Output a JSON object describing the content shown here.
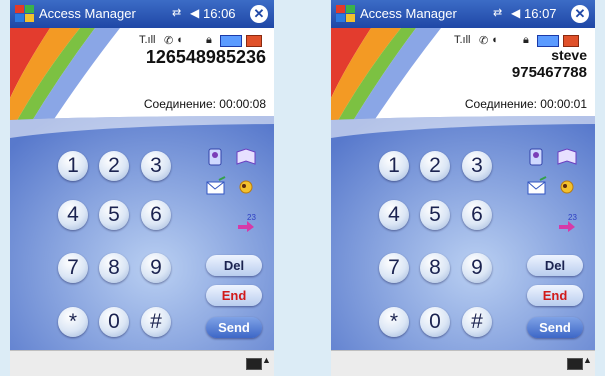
{
  "colors": {
    "titlebar": "#2454b8",
    "panel": "#6f91d9",
    "end_text": "#d11a1a",
    "send_bg": "#3d67c7",
    "background": "#dcecf6"
  },
  "screens": [
    {
      "app_title": "Access Manager",
      "time": "16:06",
      "contact_name": "",
      "number": "126548985236",
      "connection": "Соединение: 00:00:08",
      "keys": [
        "1",
        "2",
        "3",
        "4",
        "5",
        "6",
        "7",
        "8",
        "9",
        "*",
        "0",
        "#"
      ],
      "buttons": {
        "del": "Del",
        "end": "End",
        "send": "Send"
      },
      "icons": [
        "windows-start-icon",
        "network-icon",
        "volume-icon",
        "close-icon",
        "signal-icon",
        "phone-icon",
        "speaker-icon",
        "lock-icon",
        "battery-icon",
        "power-icon",
        "contacts-icon",
        "book-icon",
        "email-icon",
        "sun-icon",
        "transfer-icon",
        "keyboard-icon"
      ]
    },
    {
      "app_title": "Access Manager",
      "time": "16:07",
      "contact_name": "steve",
      "number": "975467788",
      "connection": "Соединение: 00:00:01",
      "keys": [
        "1",
        "2",
        "3",
        "4",
        "5",
        "6",
        "7",
        "8",
        "9",
        "*",
        "0",
        "#"
      ],
      "buttons": {
        "del": "Del",
        "end": "End",
        "send": "Send"
      },
      "icons": [
        "windows-start-icon",
        "network-icon",
        "volume-icon",
        "close-icon",
        "signal-icon",
        "phone-icon",
        "speaker-icon",
        "lock-icon",
        "battery-icon",
        "power-icon",
        "contacts-icon",
        "book-icon",
        "email-icon",
        "sun-icon",
        "transfer-icon",
        "keyboard-icon"
      ]
    }
  ]
}
